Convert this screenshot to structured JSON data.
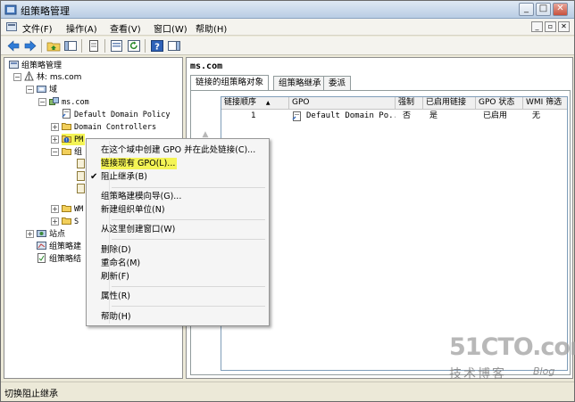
{
  "window": {
    "title": "组策略管理",
    "min": "_",
    "max": "□",
    "close": "✕"
  },
  "menubar": {
    "items": [
      "文件(F)",
      "操作(A)",
      "查看(V)",
      "窗口(W)",
      "帮助(H)"
    ],
    "mdi": [
      "_",
      "▫",
      "✕"
    ]
  },
  "toolbar": {
    "icons": [
      "back-icon",
      "forward-icon",
      "up-folder-icon",
      "show-hide-tree-icon",
      "copy-icon",
      "properties-icon",
      "refresh-icon",
      "help-icon",
      "show-hide-action-pane-icon"
    ]
  },
  "tree": {
    "root": "组策略管理",
    "forest": "林: ms.com",
    "domains": "域",
    "domain": "ms.com",
    "ddp": "Default Domain Policy",
    "dc": "Domain Controllers",
    "pm": "PM",
    "gpo_objects": "组",
    "wmi": "WM",
    "starter": "S",
    "sites": "站点",
    "modeling": "组策略建",
    "results": "组策略结"
  },
  "right": {
    "title": "ms.com",
    "tabs": [
      "链接的组策略对象",
      "组策略继承",
      "委派"
    ],
    "columns": [
      "链接顺序",
      "GPO",
      "强制",
      "已启用链接",
      "GPO 状态",
      "WMI 筛选"
    ],
    "sort_arrow": "▲",
    "rows": [
      {
        "order": "1",
        "gpo": "Default Domain Po...",
        "enforced": "否",
        "link_enabled": "是",
        "status": "已启用",
        "wmi": "无"
      }
    ],
    "up": "▲",
    "down": "▼"
  },
  "context_menu": {
    "items": [
      "在这个域中创建 GPO 并在此处链接(C)...",
      "链接现有 GPO(L)...",
      "阻止继承(B)",
      "组策略建模向导(G)...",
      "新建组织单位(N)",
      "从这里创建窗口(W)",
      "删除(D)",
      "重命名(M)",
      "刷新(F)",
      "属性(R)",
      "帮助(H)"
    ],
    "check": "✔"
  },
  "status": {
    "text": "切换阻止继承"
  },
  "watermark": {
    "main": "51CTO.com",
    "sub": "技术博客",
    "blog": "Blog"
  },
  "colors": {
    "highlight": "#f4f455",
    "title_gradient_top": "#dfe8f3",
    "title_gradient_bottom": "#b9cde4"
  }
}
